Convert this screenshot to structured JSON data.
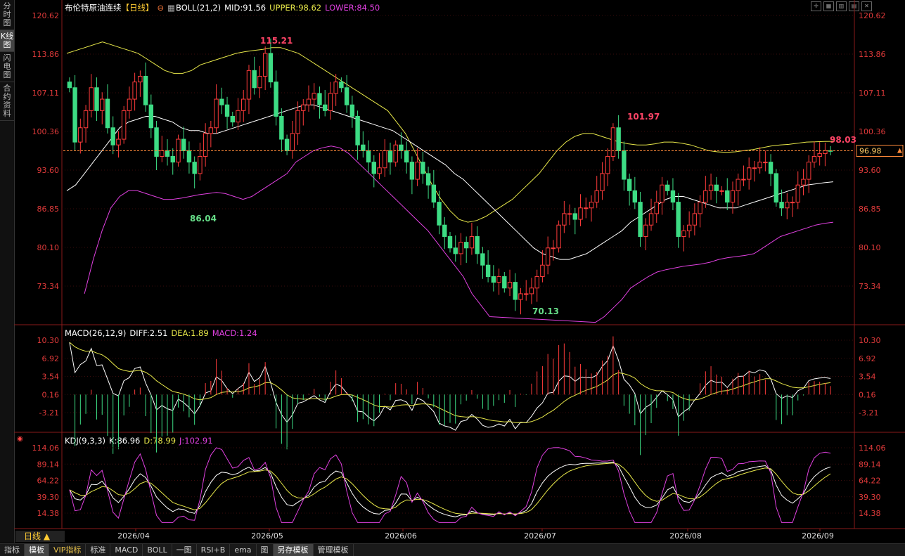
{
  "title": "布伦特原油连续",
  "period_tag": "【日线】",
  "sidebar": [
    {
      "label": "分时图"
    },
    {
      "label": "K线图",
      "active": true
    },
    {
      "label": "闪电图"
    },
    {
      "label": "合约资料"
    }
  ],
  "boll": {
    "label": "BOLL(21,2)",
    "mid": "MID:91.56",
    "upper": "UPPER:98.62",
    "lower": "LOWER:84.50"
  },
  "macd": {
    "label": "MACD(26,12,9)",
    "diff": "DIFF:2.51",
    "dea": "DEA:1.89",
    "macd": "MACD:1.24"
  },
  "kdj": {
    "label": "KDJ(9,3,3)",
    "k": "K:86.96",
    "d": "D:78.99",
    "j": "J:102.91"
  },
  "current_price": "96.98",
  "period_button": "日线",
  "bottom_tabs": [
    {
      "label": "指标"
    },
    {
      "label": "模板",
      "active": true
    },
    {
      "label": "VIP指标",
      "vip": true
    },
    {
      "label": "标准"
    },
    {
      "label": "MACD"
    },
    {
      "label": "BOLL"
    },
    {
      "label": "一图"
    },
    {
      "label": "RSI+B"
    },
    {
      "label": "ema"
    },
    {
      "label": "图"
    },
    {
      "label": "另存模板",
      "active": true
    },
    {
      "label": "管理模板"
    }
  ],
  "colors": {
    "up": "#ff3b3b",
    "down": "#3ddc84",
    "mid": "#ffffff",
    "upper": "#e8e84a",
    "lower": "#e040e0",
    "dea": "#e8e84a",
    "kdj_j": "#e040e0",
    "axis": "#e03a3a"
  },
  "chart_data": {
    "type": "candlestick",
    "price_axis_ticks": [
      120.62,
      113.86,
      107.11,
      100.36,
      93.6,
      86.85,
      80.1,
      73.34
    ],
    "macd_axis_ticks": [
      10.3,
      6.92,
      3.54,
      0.16,
      -3.21
    ],
    "kdj_axis_ticks": [
      114.06,
      89.14,
      64.22,
      39.3,
      14.38
    ],
    "x_labels": [
      "2026/04",
      "2026/05",
      "2026/06",
      "2026/07",
      "2026/08",
      "2026/09"
    ],
    "annotations": [
      {
        "text": "115.21",
        "type": "high"
      },
      {
        "text": "86.04",
        "type": "low"
      },
      {
        "text": "70.13",
        "type": "low"
      },
      {
        "text": "101.97",
        "type": "high"
      },
      {
        "text": "98.03",
        "type": "high"
      }
    ],
    "last_price": 96.98,
    "closes": [
      108,
      98.5,
      101,
      104,
      108,
      104,
      106,
      101,
      98,
      99,
      104,
      106,
      109,
      110,
      105,
      101,
      96,
      97,
      96,
      95,
      99,
      97,
      95,
      93,
      96,
      100,
      101,
      106,
      105,
      103,
      102,
      104,
      106,
      111,
      108,
      110,
      114,
      109,
      103,
      99,
      97,
      100,
      104,
      105,
      106,
      107,
      105,
      104,
      107,
      109,
      108,
      105,
      103,
      98,
      97,
      95,
      93,
      94,
      97,
      95,
      98,
      97,
      95,
      92,
      95,
      93,
      91,
      88,
      84,
      82,
      80,
      79,
      81,
      80,
      82,
      79,
      77,
      75,
      74,
      75,
      73,
      74,
      71,
      72,
      72,
      73,
      75,
      77,
      80,
      80,
      84,
      86,
      86,
      85,
      87,
      87,
      88,
      90,
      93,
      96,
      101,
      97,
      92,
      90,
      88,
      82,
      84,
      86,
      88,
      91,
      90,
      88,
      82,
      83,
      84,
      86,
      88,
      90,
      91,
      90,
      90,
      88,
      90,
      92,
      92,
      94,
      94,
      95,
      95,
      93,
      88,
      87,
      88,
      88,
      91,
      92,
      95,
      96,
      96.5,
      97,
      96.98
    ],
    "mid": [
      90,
      91,
      93,
      95,
      97,
      99,
      101,
      102,
      102.5,
      103,
      103,
      102.5,
      102,
      101,
      100.5,
      100.5,
      100,
      100,
      100.5,
      101,
      101.5,
      102,
      102.5,
      103,
      103.5,
      104,
      104.5,
      105,
      105,
      104.5,
      104,
      103.5,
      103,
      102.5,
      102,
      101.5,
      101,
      100.5,
      99.5,
      98.5,
      97.5,
      96.5,
      95.5,
      94.5,
      93,
      92,
      90.5,
      89,
      87.5,
      86,
      84.5,
      83,
      81.5,
      80,
      79,
      78.5,
      78,
      78,
      78.5,
      79,
      80,
      81,
      82,
      83,
      84.5,
      85.5,
      86.5,
      87.5,
      88.5,
      89,
      89,
      88.5,
      88,
      87.5,
      87,
      87,
      87,
      87.5,
      88,
      88.5,
      89,
      89.5,
      90,
      90.5,
      91,
      91.2,
      91.4,
      91.56
    ],
    "upper": [
      114,
      114.5,
      115,
      115.5,
      116,
      115.5,
      115,
      114.5,
      114,
      113,
      112,
      111,
      110.5,
      110.5,
      111,
      112,
      112.5,
      113,
      113.5,
      114,
      114.3,
      114.5,
      114.7,
      115,
      115,
      114.5,
      114,
      113,
      112,
      111,
      110,
      109,
      108,
      107,
      106,
      105,
      104,
      102,
      100,
      97,
      94,
      91,
      88.5,
      86.5,
      85,
      84.5,
      84.8,
      85.5,
      86.5,
      87.5,
      88.5,
      90,
      91.5,
      93,
      95,
      97,
      98.5,
      99.5,
      100,
      100,
      99.5,
      99,
      98.5,
      98.2,
      98,
      98,
      98.2,
      98.5,
      98.5,
      98.3,
      98,
      97.5,
      97,
      96.8,
      96.7,
      96.8,
      97,
      97.2,
      97.5,
      97.8,
      98,
      98.1,
      98.3,
      98.5,
      98.55,
      98.6,
      98.62
    ],
    "lower": [
      58,
      66,
      72,
      78,
      83,
      87,
      89,
      90,
      90,
      89.5,
      89,
      88.5,
      88.5,
      88.7,
      89,
      89.3,
      89.5,
      89.7,
      89.5,
      89,
      88.5,
      89,
      90,
      91,
      92,
      93,
      95,
      96,
      97,
      97.5,
      97.8,
      97.5,
      96.5,
      95,
      93.5,
      92,
      90.5,
      89,
      87.5,
      86,
      84.5,
      83,
      81,
      79,
      77,
      75,
      72,
      70,
      68,
      66,
      65,
      64,
      63,
      62.5,
      62.5,
      63,
      63.5,
      64,
      65,
      66,
      67,
      68,
      69.5,
      71,
      73,
      74,
      75,
      75.8,
      76.2,
      76.5,
      76.8,
      77,
      77.2,
      77.5,
      78,
      78.3,
      78.5,
      78.7,
      79,
      80,
      81,
      82,
      82.5,
      83,
      83.5,
      84,
      84.3,
      84.5
    ]
  }
}
